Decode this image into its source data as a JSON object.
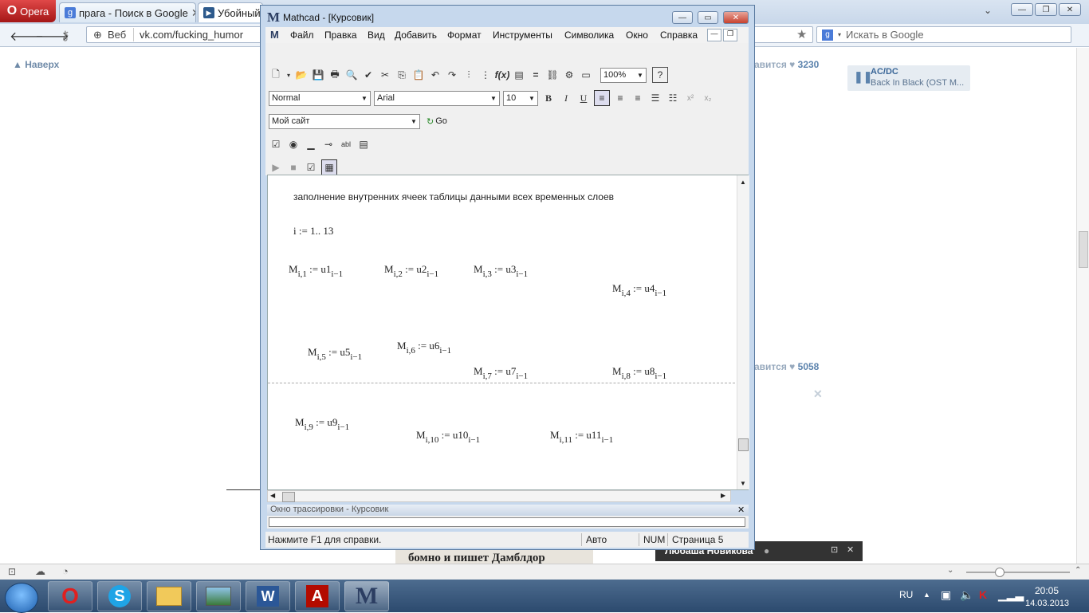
{
  "browser": {
    "opera_label": "Opera",
    "tabs": [
      {
        "title": "прага - Поиск в Google"
      },
      {
        "title": "Убойный"
      }
    ],
    "address": {
      "web_badge": "Веб",
      "url": "vk.com/fucking_humor"
    },
    "search": {
      "placeholder": "Искать в Google"
    }
  },
  "vk": {
    "up_label": "Наверх",
    "like_word": "авится",
    "likes": [
      "3230",
      "5058"
    ],
    "audio": {
      "title": "AC/DC",
      "subtitle": "Back In Black (OST M..."
    },
    "notification": {
      "name": "Любаша Новикова"
    },
    "bottom_text": "бомно и пишет Дамблдор"
  },
  "mathcad": {
    "title": "Mathcad - [Курсовик]",
    "menu": [
      "Файл",
      "Правка",
      "Вид",
      "Добавить",
      "Формат",
      "Инструменты",
      "Символика",
      "Окно",
      "Справка"
    ],
    "zoom": "100%",
    "style_combo": "Normal",
    "font_combo": "Arial",
    "size_combo": "10",
    "resource_combo": "Мой сайт",
    "go_label": "Go",
    "doc": {
      "heading": "заполнение внутренних ячеек таблицы данными всех временных слоев",
      "range_var": "i",
      "range_def": ":= 1.. 13",
      "assign": [
        {
          "idx": "1",
          "src": "u1"
        },
        {
          "idx": "2",
          "src": "u2"
        },
        {
          "idx": "3",
          "src": "u3"
        },
        {
          "idx": "4",
          "src": "u4"
        },
        {
          "idx": "5",
          "src": "u5"
        },
        {
          "idx": "6",
          "src": "u6"
        },
        {
          "idx": "7",
          "src": "u7"
        },
        {
          "idx": "8",
          "src": "u8"
        },
        {
          "idx": "9",
          "src": "u9"
        },
        {
          "idx": "10",
          "src": "u10"
        },
        {
          "idx": "11",
          "src": "u11"
        }
      ]
    },
    "trace_title": "Окно трассировки - Курсовик",
    "status": {
      "help": "Нажмите F1 для справки.",
      "mode": "Авто",
      "num": "NUM",
      "page": "Страница 5"
    }
  },
  "taskbar": {
    "lang": "RU",
    "time": "20:05",
    "date": "14.03.2013"
  }
}
